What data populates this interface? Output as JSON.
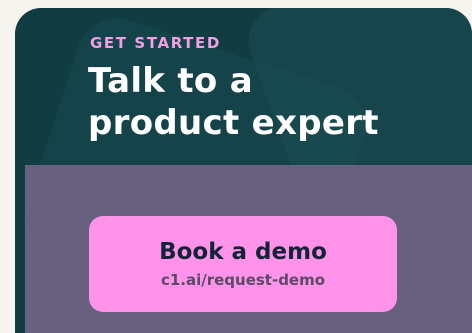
{
  "card": {
    "eyebrow": "GET STARTED",
    "headline_line1": "Talk to a",
    "headline_line2": "product expert",
    "cta_title": "Book a demo",
    "cta_url": "c1.ai/request-demo"
  },
  "colors": {
    "card_background": "#103c42",
    "eyebrow": "#f49ee6",
    "headline": "#ffffff",
    "band": "#67617f",
    "cta_background": "#ff93ea",
    "cta_text": "#15233a"
  }
}
